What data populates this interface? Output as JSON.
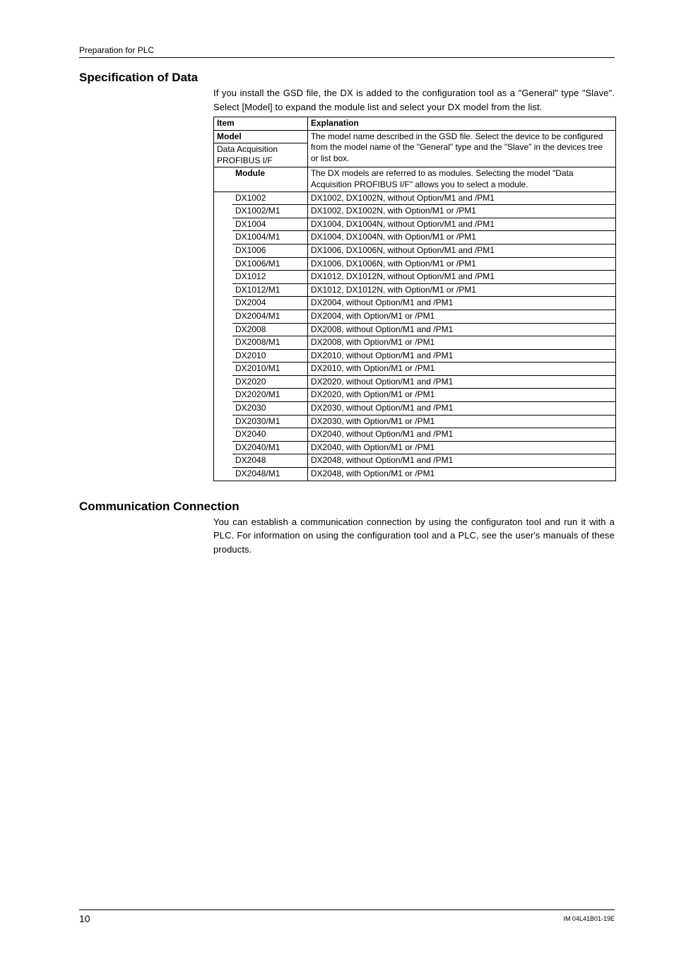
{
  "running_header": "Preparation for PLC",
  "spec": {
    "heading": "Specification of Data",
    "intro": "If you install the GSD file, the DX is added to the configuration tool as a \"General\" type \"Slave\". Select [Model] to expand the module list and select your DX model from the list.",
    "col_item": "Item",
    "col_expl": "Explanation",
    "model_label": "Model",
    "model_expl": "The model name described in the GSD file. Select the device to be configured from the model name of the \"General\" type and the \"Slave\" in the devices tree or list box.",
    "daq_label": "Data Acquisition PROFIBUS I/F",
    "module_label": "Module",
    "module_expl": "The DX models are referred to as modules. Selecting the model \"Data Acquisition PROFIBUS I/F\" allows you to select a module.",
    "rows": [
      {
        "item": "DX1002",
        "expl": "DX1002, DX1002N, without Option/M1 and /PM1"
      },
      {
        "item": "DX1002/M1",
        "expl": "DX1002, DX1002N, with Option/M1 or /PM1"
      },
      {
        "item": "DX1004",
        "expl": "DX1004, DX1004N, without Option/M1 and /PM1"
      },
      {
        "item": "DX1004/M1",
        "expl": "DX1004, DX1004N, with Option/M1 or /PM1"
      },
      {
        "item": "DX1006",
        "expl": "DX1006, DX1006N, without Option/M1 and /PM1"
      },
      {
        "item": "DX1006/M1",
        "expl": "DX1006, DX1006N, with Option/M1 or /PM1"
      },
      {
        "item": "DX1012",
        "expl": "DX1012, DX1012N, without Option/M1 and /PM1"
      },
      {
        "item": "DX1012/M1",
        "expl": "DX1012, DX1012N, with Option/M1 or /PM1"
      },
      {
        "item": "DX2004",
        "expl": "DX2004, without Option/M1 and /PM1"
      },
      {
        "item": "DX2004/M1",
        "expl": "DX2004, with Option/M1 or /PM1"
      },
      {
        "item": "DX2008",
        "expl": "DX2008, without Option/M1 and /PM1"
      },
      {
        "item": "DX2008/M1",
        "expl": "DX2008, with Option/M1 or /PM1"
      },
      {
        "item": "DX2010",
        "expl": "DX2010, without Option/M1 and /PM1"
      },
      {
        "item": "DX2010/M1",
        "expl": "DX2010, with Option/M1 or /PM1"
      },
      {
        "item": "DX2020",
        "expl": "DX2020, without Option/M1 and /PM1"
      },
      {
        "item": "DX2020/M1",
        "expl": "DX2020, with Option/M1 or /PM1"
      },
      {
        "item": "DX2030",
        "expl": "DX2030, without Option/M1 and /PM1"
      },
      {
        "item": "DX2030/M1",
        "expl": "DX2030, with Option/M1 or /PM1"
      },
      {
        "item": "DX2040",
        "expl": "DX2040, without Option/M1 and /PM1"
      },
      {
        "item": "DX2040/M1",
        "expl": "DX2040, with Option/M1 or /PM1"
      },
      {
        "item": "DX2048",
        "expl": "DX2048, without Option/M1 and /PM1"
      },
      {
        "item": "DX2048/M1",
        "expl": "DX2048, with Option/M1 or /PM1"
      }
    ]
  },
  "comm": {
    "heading": "Communication Connection",
    "para": "You can establish a communication connection by using the configuraton tool and run it with a PLC. For information on using the configuration tool and a PLC, see the user's manuals of these products."
  },
  "footer": {
    "page": "10",
    "doc_id": "IM 04L41B01-19E"
  }
}
